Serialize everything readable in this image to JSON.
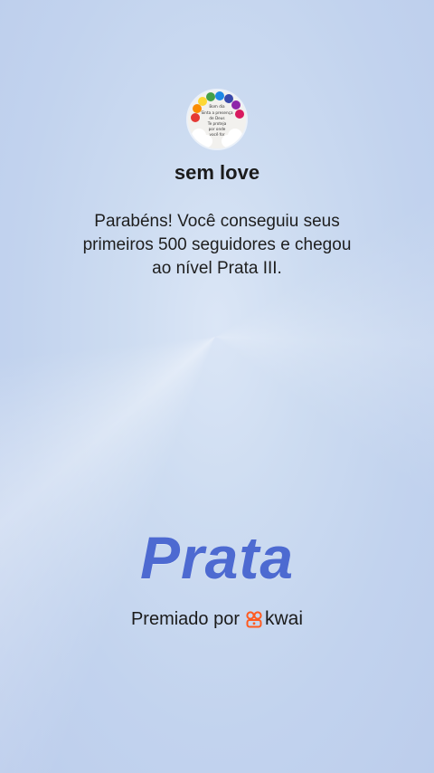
{
  "profile": {
    "username": "sem love",
    "avatar_text": [
      "Bom dia",
      "Sinta a presença",
      "de Deus",
      "Te proteja",
      "por onde",
      "você for"
    ]
  },
  "message": {
    "line1": "Parabéns! Você conseguiu seus",
    "line2": "primeiros 500 seguidores e chegou",
    "line3": "ao nível Prata III."
  },
  "level": {
    "word": "Prata",
    "color": "#4d6ad1"
  },
  "footer": {
    "awarded_by": "Premiado por",
    "brand": "kwai",
    "brand_icon": "kwai-logo-icon",
    "brand_color": "#ff5a1f"
  }
}
